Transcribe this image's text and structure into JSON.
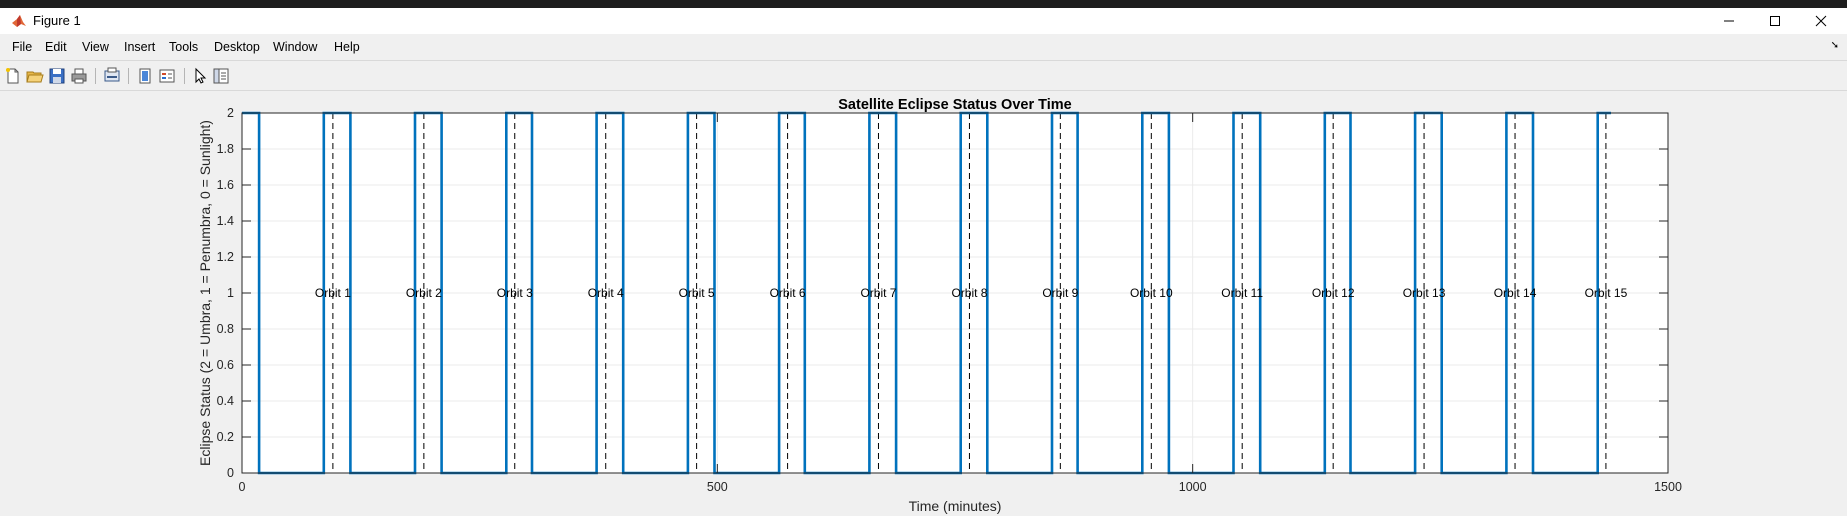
{
  "window": {
    "title": "Figure 1",
    "icon": "matlab-icon"
  },
  "menu": [
    "File",
    "Edit",
    "View",
    "Insert",
    "Tools",
    "Desktop",
    "Window",
    "Help"
  ],
  "toolbar": {
    "icons": [
      "new-figure-icon",
      "open-file-icon",
      "save-icon",
      "print-icon",
      "print-preview-icon",
      "link-plot-icon",
      "insert-colorbar-icon",
      "insert-legend-icon",
      "edit-plot-icon",
      "property-inspector-icon"
    ]
  },
  "colors": {
    "series": "#0072BD",
    "dashed": "#000000",
    "axes_bg": "#ffffff",
    "grid": "#ebebeb"
  },
  "chart_data": {
    "type": "line",
    "title": "Satellite Eclipse Status Over Time",
    "xlabel": "Time (minutes)",
    "ylabel": "Eclipse Status (2 = Umbra, 1 = Penumbra, 0 = Sunlight)",
    "xlim": [
      0,
      1500
    ],
    "ylim": [
      0,
      2
    ],
    "xticks": [
      0,
      500,
      1000,
      1500
    ],
    "yticks": [
      0,
      0.2,
      0.4,
      0.6,
      0.8,
      1,
      1.2,
      1.4,
      1.6,
      1.8,
      2
    ],
    "grid": true,
    "series": [
      {
        "x": [
          0,
          18,
          18,
          86,
          86,
          114,
          114,
          182,
          182,
          210,
          210,
          278,
          278,
          305,
          305,
          373,
          373,
          401,
          401,
          469,
          469,
          497,
          497,
          565,
          565,
          592,
          592,
          660,
          660,
          688,
          688,
          756,
          756,
          784,
          784,
          852,
          852,
          879,
          879,
          947,
          947,
          975,
          975,
          1043,
          1043,
          1071,
          1071,
          1139,
          1139,
          1166,
          1166,
          1234,
          1234,
          1262,
          1262,
          1330,
          1330,
          1358,
          1358,
          1426,
          1426,
          1440
        ],
        "y": [
          2,
          2,
          0,
          0,
          2,
          2,
          0,
          0,
          2,
          2,
          0,
          0,
          2,
          2,
          0,
          0,
          2,
          2,
          0,
          0,
          2,
          2,
          0,
          0,
          2,
          2,
          0,
          0,
          2,
          2,
          0,
          0,
          2,
          2,
          0,
          0,
          2,
          2,
          0,
          0,
          2,
          2,
          0,
          0,
          2,
          2,
          0,
          0,
          2,
          2,
          0,
          0,
          2,
          2,
          0,
          0,
          2,
          2,
          0,
          0,
          2,
          2
        ]
      }
    ],
    "vlines": [
      95.6,
      191.3,
      286.9,
      382.6,
      478.2,
      573.9,
      669.5,
      765.2,
      860.8,
      956.5,
      1052.1,
      1147.8,
      1243.4,
      1339.1,
      1434.7
    ],
    "annotations": {
      "y": 1,
      "labels": [
        "Orbit 1",
        "Orbit 2",
        "Orbit 3",
        "Orbit 4",
        "Orbit 5",
        "Orbit 6",
        "Orbit 7",
        "Orbit 8",
        "Orbit 9",
        "Orbit 10",
        "Orbit 11",
        "Orbit 12",
        "Orbit 13",
        "Orbit 14",
        "Orbit 15"
      ]
    }
  }
}
